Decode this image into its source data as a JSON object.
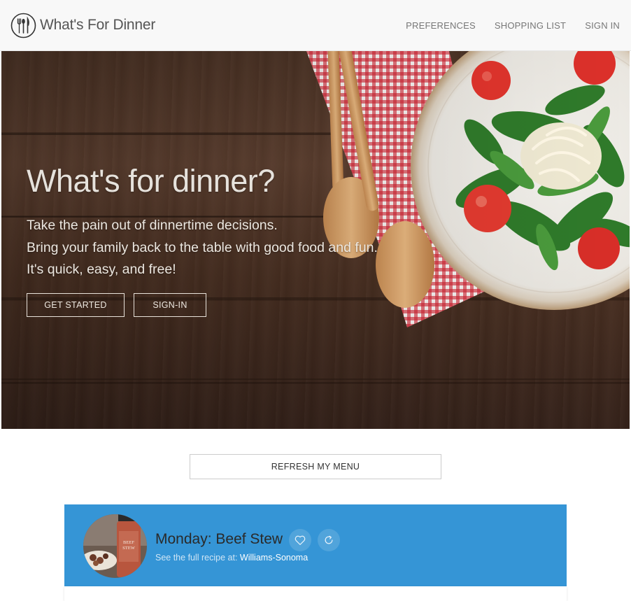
{
  "navbar": {
    "brand": "What's For Dinner",
    "links": [
      "PREFERENCES",
      "SHOPPING LIST",
      "SIGN IN"
    ],
    "logo_icon": "fork-spoon-knife-icon"
  },
  "hero": {
    "title": "What's for dinner?",
    "lines": [
      "Take the pain out of dinnertime decisions.",
      "Bring your family back to the table with good food and fun.",
      "It's quick, easy, and free!"
    ],
    "get_started_label": "GET STARTED",
    "signin_label": "SIGN-IN"
  },
  "refresh_label": "REFRESH MY MENU",
  "menu": {
    "day": "Monday",
    "meal": "Beef Stew",
    "title": "Monday: Beef Stew",
    "recipe_prefix": "See the full recipe at:",
    "recipe_source": "Williams-Sonoma",
    "favorite_icon": "heart-icon",
    "refresh_icon": "refresh-icon",
    "avatar_label": "BEEF STEW",
    "card_color": "#3595d6"
  }
}
